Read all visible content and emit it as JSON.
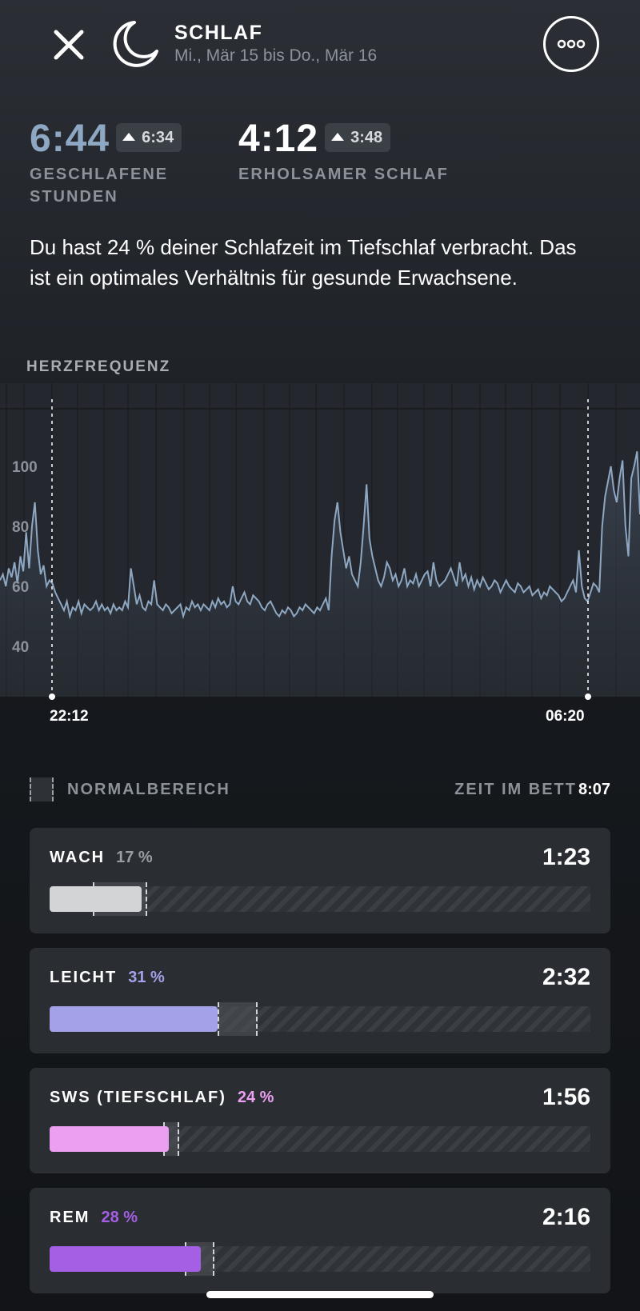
{
  "header": {
    "title": "SCHLAF",
    "date_range": "Mi., Mär 15 bis Do., Mär 16"
  },
  "stats": {
    "hours_slept": {
      "value": "6:44",
      "badge": "6:34",
      "label_line1": "GESCHLAFENE",
      "label_line2": "STUNDEN",
      "value_color": "#8ea7c2"
    },
    "restorative": {
      "value": "4:12",
      "badge": "3:48",
      "label": "ERHOLSAMER SCHLAF"
    }
  },
  "insight": "Du hast 24 % deiner Schlafzeit im Tiefschlaf verbracht. Das ist ein optimales Verhältnis für gesunde Erwachsene.",
  "heart_rate": {
    "label": "HERZFREQUENZ",
    "start_time": "22:12",
    "end_time": "06:20"
  },
  "chart_data": {
    "type": "area",
    "ylabel": "",
    "y_ticks": [
      "100",
      "80",
      "60",
      "40"
    ],
    "ylim": [
      30,
      110
    ],
    "x_labels": [
      "22:12",
      "06:20"
    ],
    "line_color": "#8ea7c2",
    "series": [
      {
        "values": [
          62,
          64,
          60,
          66,
          63,
          68,
          61,
          70,
          65,
          78,
          66,
          80,
          88,
          72,
          64,
          67,
          60,
          62,
          61,
          58,
          56,
          54,
          52,
          55,
          50,
          53,
          52,
          55,
          51,
          54,
          53,
          52,
          53,
          55,
          52,
          54,
          52,
          53,
          51,
          54,
          52,
          53,
          52,
          55,
          53,
          66,
          60,
          54,
          57,
          53,
          52,
          55,
          54,
          62,
          54,
          53,
          52,
          54,
          53,
          51,
          52,
          53,
          54,
          50,
          53,
          52,
          55,
          53,
          54,
          52,
          54,
          53,
          52,
          55,
          53,
          56,
          54,
          55,
          53,
          54,
          60,
          55,
          54,
          56,
          58,
          55,
          54,
          57,
          56,
          55,
          53,
          52,
          54,
          55,
          53,
          51,
          50,
          52,
          51,
          53,
          52,
          50,
          51,
          53,
          52,
          54,
          53,
          52,
          51,
          53,
          52,
          54,
          56,
          52,
          70,
          82,
          88,
          78,
          72,
          66,
          70,
          64,
          62,
          60,
          68,
          80,
          94,
          76,
          70,
          66,
          62,
          60,
          63,
          68,
          66,
          62,
          64,
          60,
          62,
          66,
          60,
          62,
          61,
          64,
          60,
          62,
          64,
          65,
          60,
          68,
          62,
          60,
          61,
          62,
          64,
          66,
          63,
          60,
          68,
          62,
          64,
          60,
          63,
          59,
          62,
          60,
          63,
          61,
          59,
          60,
          62,
          61,
          58,
          60,
          62,
          60,
          59,
          58,
          61,
          60,
          58,
          59,
          60,
          57,
          58,
          59,
          56,
          58,
          57,
          60,
          59,
          58,
          57,
          55,
          56,
          58,
          60,
          62,
          58,
          72,
          60,
          56,
          55,
          58,
          61,
          60,
          58,
          80,
          90,
          95,
          100,
          92,
          88,
          96,
          102,
          80,
          70,
          96,
          100,
          105,
          84
        ]
      }
    ]
  },
  "legend": {
    "normal_range": "NORMALBEREICH",
    "time_in_bed_label": "ZEIT IM BETT",
    "time_in_bed": "8:07"
  },
  "stages": [
    {
      "name": "WACH",
      "percent": "17 %",
      "time": "1:23",
      "fraction": 0.17,
      "normal_low": 0.08,
      "normal_high": 0.18,
      "color": "#d3d4d6",
      "pct_color": "#9a9ea4"
    },
    {
      "name": "LEICHT",
      "percent": "31 %",
      "time": "2:32",
      "fraction": 0.31,
      "normal_low": 0.31,
      "normal_high": 0.385,
      "color": "#a3a1e8",
      "pct_color": "#a3a1e8"
    },
    {
      "name": "SWS (TIEFSCHLAF)",
      "percent": "24 %",
      "time": "1:56",
      "fraction": 0.22,
      "normal_low": 0.21,
      "normal_high": 0.24,
      "color": "#ec9ef0",
      "pct_color": "#ec9ef0"
    },
    {
      "name": "REM",
      "percent": "28 %",
      "time": "2:16",
      "fraction": 0.28,
      "normal_low": 0.25,
      "normal_high": 0.305,
      "color": "#a55fe4",
      "pct_color": "#a55fe4"
    }
  ]
}
